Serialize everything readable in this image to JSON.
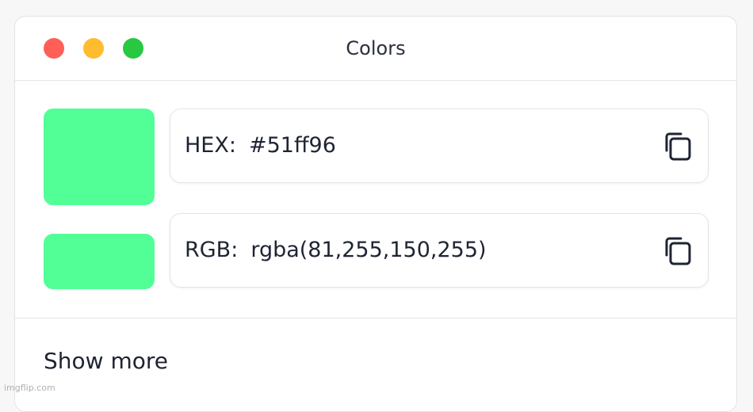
{
  "window": {
    "title": "Colors",
    "traffic_lights": {
      "close_color": "#ff5f57",
      "minimize_color": "#febc2e",
      "zoom_color": "#28c840"
    }
  },
  "color": {
    "swatch_color": "#51ff96",
    "hex": {
      "label": "HEX:",
      "value": "#51ff96",
      "copy_icon": "copy-icon"
    },
    "rgb": {
      "label": "RGB:",
      "value": "rgba(81,255,150,255)",
      "copy_icon": "copy-icon"
    }
  },
  "footer": {
    "show_more_label": "Show more"
  },
  "watermark": "imgflip.com"
}
